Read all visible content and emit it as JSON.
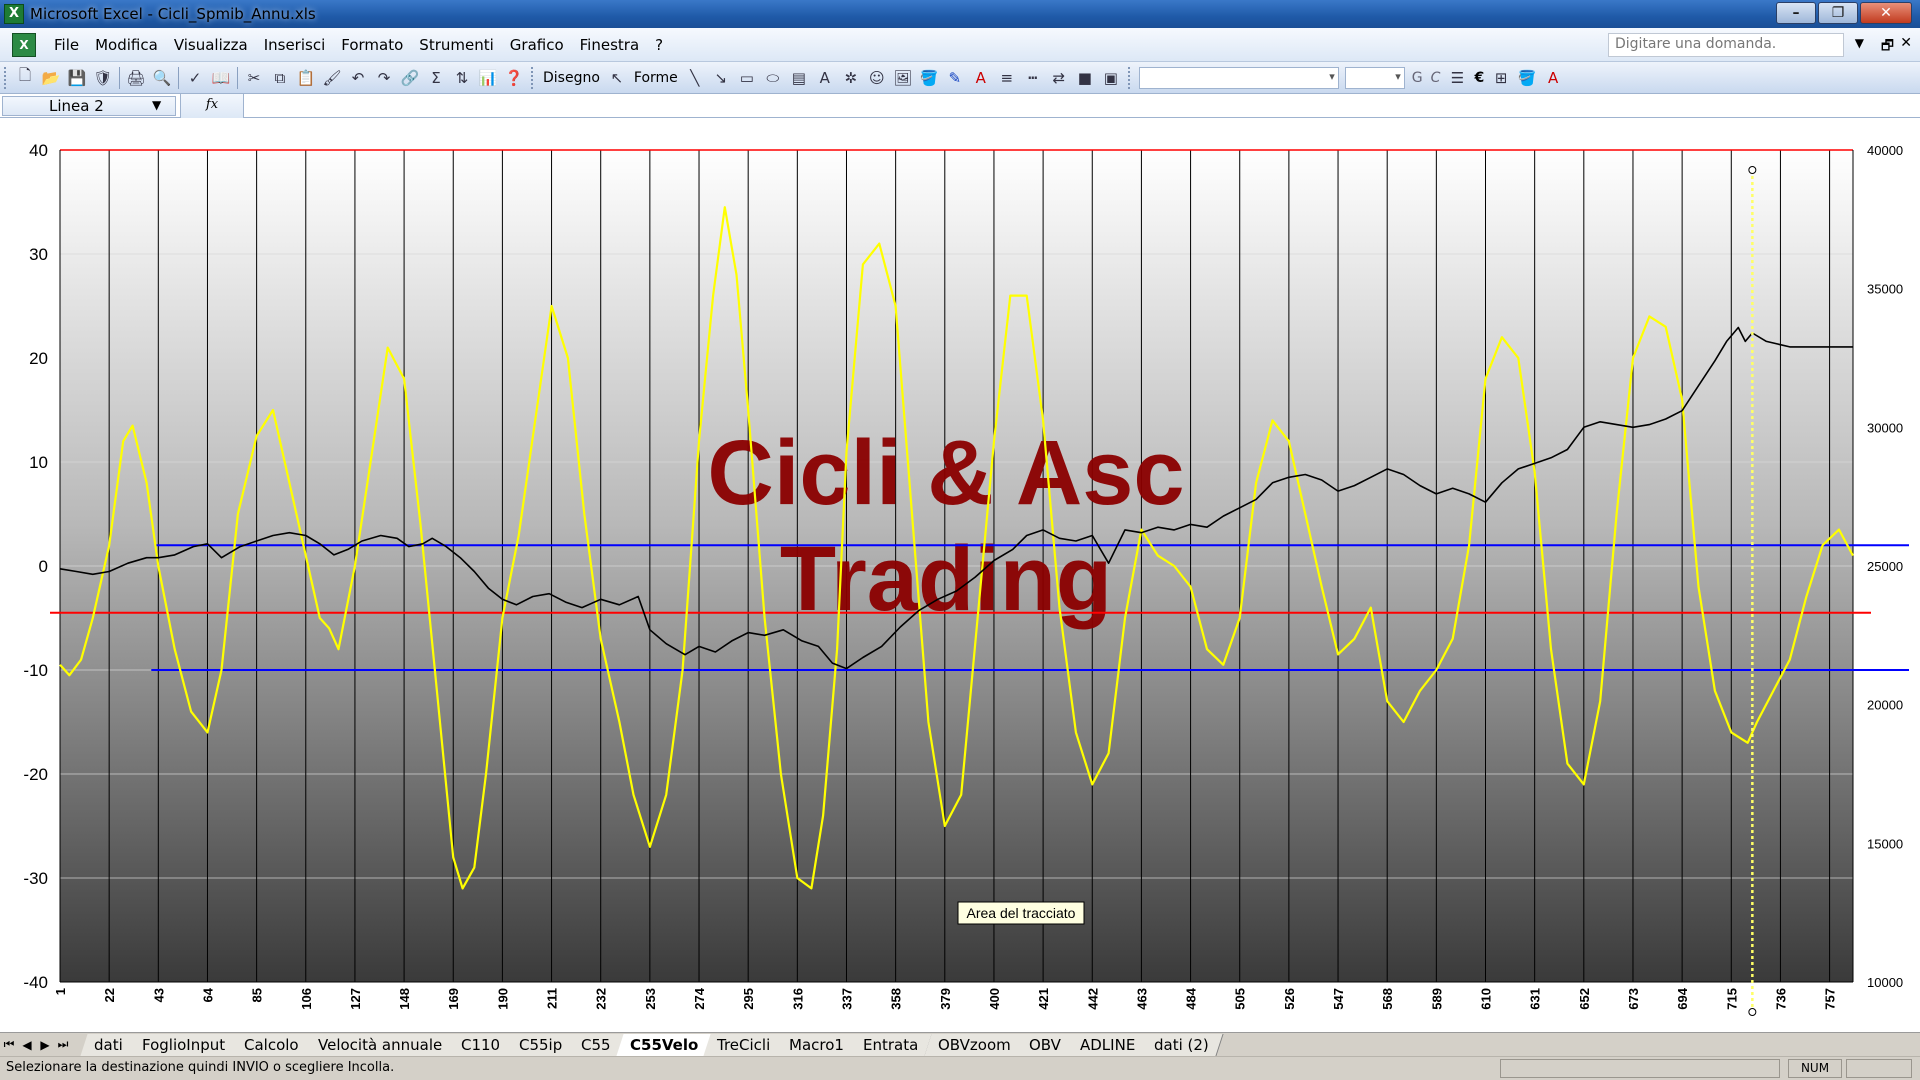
{
  "window": {
    "title": "Microsoft Excel - Cicli_Spmib_Annu.xls",
    "app_icon": "X"
  },
  "menu": {
    "items": [
      {
        "label": "File"
      },
      {
        "label": "Modifica"
      },
      {
        "label": "Visualizza"
      },
      {
        "label": "Inserisci"
      },
      {
        "label": "Formato"
      },
      {
        "label": "Strumenti"
      },
      {
        "label": "Grafico"
      },
      {
        "label": "Finestra"
      },
      {
        "label": "?"
      }
    ],
    "help_placeholder": "Digitare una domanda."
  },
  "toolbar": {
    "draw_label": "Disegno",
    "shapes_label": "Forme",
    "bold": "G",
    "italic": "C",
    "currency": "€"
  },
  "formula_bar": {
    "name_box": "Linea 2",
    "fx": "fx"
  },
  "chart_data": {
    "type": "line",
    "watermark": [
      "Cicli & Asc",
      "Trading"
    ],
    "tooltip": "Area del tracciato",
    "y_left": {
      "min": -40,
      "max": 40,
      "ticks": [
        40,
        30,
        20,
        10,
        0,
        -10,
        -20,
        -30,
        -40
      ]
    },
    "y_right": {
      "min": 10000,
      "max": 40000,
      "ticks": [
        40000,
        35000,
        30000,
        25000,
        20000,
        15000,
        10000
      ]
    },
    "x_ticks": [
      "1",
      "22",
      "43",
      "64",
      "85",
      "106",
      "127",
      "148",
      "169",
      "190",
      "211",
      "232",
      "253",
      "274",
      "295",
      "316",
      "337",
      "358",
      "379",
      "400",
      "421",
      "442",
      "463",
      "484",
      "505",
      "526",
      "547",
      "568",
      "589",
      "610",
      "631",
      "652",
      "673",
      "694",
      "715",
      "736",
      "757"
    ],
    "x_range": [
      1,
      767
    ],
    "cursor_x": 724,
    "hlines": [
      {
        "y": 2,
        "color": "#0000ff",
        "from": 42
      },
      {
        "y": -4.5,
        "color": "#ff0000",
        "from": 0
      },
      {
        "y": -10,
        "color": "#0000ff",
        "from": 40
      }
    ],
    "series": [
      {
        "color": "#ffff00",
        "axis": "left",
        "x": [
          1,
          5,
          10,
          15,
          22,
          28,
          32,
          38,
          43,
          50,
          57,
          64,
          70,
          77,
          85,
          92,
          99,
          106,
          112,
          116,
          120,
          127,
          135,
          141,
          148,
          155,
          162,
          169,
          173,
          178,
          183,
          190,
          197,
          204,
          211,
          218,
          225,
          232,
          240,
          246,
          253,
          260,
          267,
          274,
          280,
          285,
          290,
          295,
          302,
          309,
          316,
          322,
          327,
          333,
          337,
          344,
          351,
          358,
          365,
          372,
          379,
          386,
          393,
          400,
          407,
          414,
          421,
          428,
          435,
          442,
          449,
          456,
          463,
          470,
          477,
          484,
          491,
          498,
          505,
          512,
          519,
          526,
          533,
          540,
          547,
          554,
          561,
          568,
          575,
          582,
          589,
          596,
          603,
          610,
          617,
          624,
          631,
          638,
          645,
          652,
          659,
          666,
          673,
          680,
          687,
          694,
          701,
          708,
          715,
          722,
          726,
          733,
          740,
          747,
          754,
          761,
          767
        ],
        "y": [
          -9.5,
          -10.5,
          -9,
          -5,
          2,
          12,
          13.5,
          8,
          0,
          -8,
          -14,
          -16,
          -10,
          5,
          12.5,
          15,
          8,
          1,
          -5,
          -6,
          -8,
          0,
          12,
          21,
          18,
          4,
          -12,
          -28,
          -31,
          -29,
          -20,
          -5,
          3,
          14,
          25,
          20,
          5,
          -7,
          -15,
          -22,
          -27,
          -22,
          -10,
          12,
          26,
          34.5,
          28,
          15,
          -5,
          -20,
          -30,
          -31,
          -24,
          -8,
          11,
          29,
          31,
          25,
          5,
          -15,
          -25,
          -22,
          -5,
          12,
          26,
          26,
          14,
          -4,
          -16,
          -21,
          -18,
          -5,
          3.5,
          1,
          0,
          -2,
          -8,
          -9.5,
          -5,
          8,
          14,
          12,
          5,
          -2,
          -8.5,
          -7,
          -4,
          -13,
          -15,
          -12,
          -10,
          -7,
          2,
          18,
          22,
          20,
          9,
          -8,
          -19,
          -21,
          -13,
          5,
          20,
          24,
          23,
          16,
          -2,
          -12,
          -16,
          -17,
          -15,
          -12,
          -9,
          -3,
          2,
          3.5,
          1
        ]
      },
      {
        "color": "#000000",
        "axis": "right",
        "x": [
          1,
          8,
          15,
          22,
          30,
          38,
          43,
          50,
          58,
          64,
          70,
          78,
          85,
          92,
          99,
          106,
          112,
          118,
          124,
          130,
          138,
          145,
          150,
          156,
          160,
          166,
          172,
          178,
          184,
          190,
          196,
          203,
          210,
          217,
          224,
          232,
          240,
          248,
          253,
          260,
          268,
          274,
          281,
          288,
          295,
          302,
          310,
          318,
          325,
          331,
          337,
          344,
          352,
          360,
          368,
          376,
          384,
          392,
          400,
          408,
          414,
          421,
          428,
          435,
          442,
          449,
          456,
          463,
          470,
          477,
          484,
          491,
          498,
          505,
          512,
          519,
          526,
          533,
          540,
          547,
          554,
          561,
          568,
          575,
          582,
          589,
          596,
          603,
          610,
          617,
          624,
          631,
          638,
          645,
          652,
          659,
          666,
          673,
          680,
          687,
          694,
          701,
          708,
          713,
          718,
          721,
          724,
          730,
          740,
          750,
          760,
          767
        ],
        "y": [
          24900,
          24800,
          24700,
          24800,
          25100,
          25300,
          25300,
          25400,
          25700,
          25800,
          25300,
          25700,
          25900,
          26100,
          26200,
          26100,
          25800,
          25400,
          25600,
          25900,
          26100,
          26000,
          25700,
          25800,
          26000,
          25700,
          25300,
          24800,
          24200,
          23800,
          23600,
          23900,
          24000,
          23700,
          23500,
          23800,
          23600,
          23900,
          22700,
          22200,
          21800,
          22100,
          21900,
          22300,
          22600,
          22500,
          22700,
          22300,
          22100,
          21500,
          21300,
          21700,
          22100,
          22800,
          23400,
          23800,
          24100,
          24600,
          25200,
          25600,
          26100,
          26300,
          26000,
          25900,
          26100,
          25100,
          26300,
          26200,
          26400,
          26300,
          26500,
          26400,
          26800,
          27100,
          27400,
          28000,
          28200,
          28300,
          28100,
          27700,
          27900,
          28200,
          28500,
          28300,
          27900,
          27600,
          27800,
          27600,
          27300,
          28000,
          28500,
          28700,
          28900,
          29200,
          30000,
          30200,
          30100,
          30000,
          30100,
          30300,
          30600,
          31500,
          32400,
          33100,
          33600,
          33100,
          33400,
          33100,
          32900,
          32900,
          32900,
          32900
        ]
      }
    ]
  },
  "sheet_tabs": [
    "dati",
    "FoglioInput",
    "Calcolo",
    "Velocità annuale",
    "C110",
    "C55ip",
    "C55",
    "C55Velo",
    "TreCicli",
    "Macro1",
    "Entrata",
    "OBVzoom",
    "OBV",
    "ADLINE",
    "dati (2)"
  ],
  "active_tab": "C55Velo",
  "status": {
    "message": "Selezionare la destinazione quindi INVIO o scegliere Incolla.",
    "num": "NUM"
  }
}
